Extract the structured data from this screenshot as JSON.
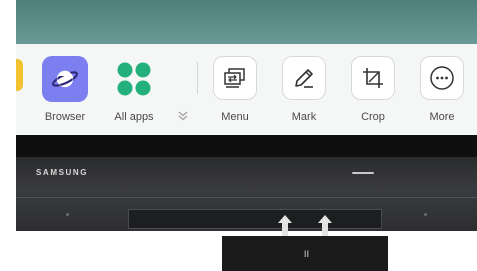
{
  "dock": {
    "apps": [
      {
        "label": "Browser",
        "icon": "planet-browser-icon",
        "color": "#7b7ff0"
      },
      {
        "label": "All apps",
        "icon": "grid-dots-icon",
        "color": "#23b07d"
      }
    ],
    "tools": [
      {
        "label": "Menu",
        "icon": "screens-switch-icon"
      },
      {
        "label": "Mark",
        "icon": "pencil-icon"
      },
      {
        "label": "Crop",
        "icon": "crop-icon"
      },
      {
        "label": "More",
        "icon": "more-dots-icon"
      }
    ]
  },
  "device": {
    "brand": "SAMSUNG",
    "stand_label": "II"
  },
  "colors": {
    "screen": "#5e8f8a",
    "dock_background": "#f5f6f6",
    "bezel": "#2f3033",
    "accent_yellow": "#f2c230"
  }
}
